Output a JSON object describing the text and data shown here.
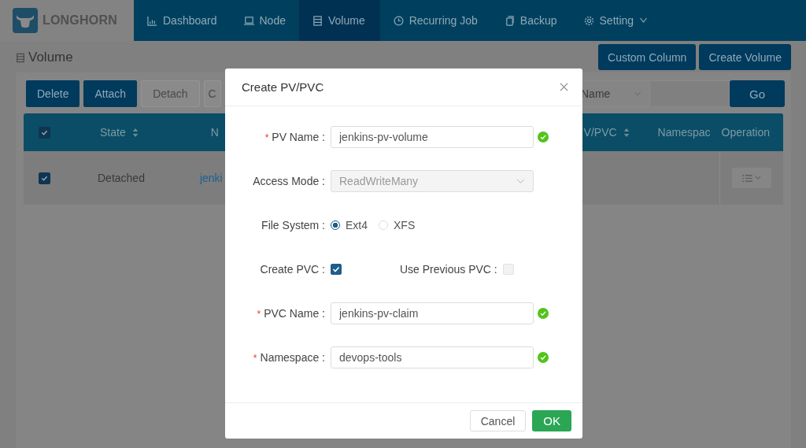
{
  "app": {
    "logo": "LONGHORN"
  },
  "nav": [
    {
      "label": "Dashboard",
      "selected": false
    },
    {
      "label": "Node",
      "selected": false
    },
    {
      "label": "Volume",
      "selected": true
    },
    {
      "label": "Recurring Job",
      "selected": false
    },
    {
      "label": "Backup",
      "selected": false
    },
    {
      "label": "Setting",
      "selected": false,
      "dropdown": true
    }
  ],
  "page": {
    "title": "Volume",
    "buttons": [
      "Custom Column",
      "Create Volume"
    ]
  },
  "toolbar": {
    "buttons": [
      {
        "label": "Delete",
        "disabled": false
      },
      {
        "label": "Attach",
        "disabled": false
      },
      {
        "label": "Detach",
        "disabled": true
      },
      {
        "label": "C",
        "disabled": true
      }
    ],
    "filter": {
      "field": "Name",
      "button": "Go"
    }
  },
  "table": {
    "select_all": true,
    "columns_left": [
      {
        "label": "State",
        "sortable": true
      },
      {
        "label": "N"
      }
    ],
    "columns_right": [
      {
        "label": "V/PVC",
        "sortable": true
      },
      {
        "label": "Namespac"
      },
      {
        "label": "Operation"
      }
    ],
    "rows": [
      {
        "checked": true,
        "state": "Detached",
        "name": "jenki"
      }
    ]
  },
  "dialog": {
    "title": "Create PV/PVC",
    "fields": [
      {
        "kind": "text",
        "marker": "*",
        "label": "PV Name :",
        "value": "jenkins-pv-volume",
        "valid": true
      },
      {
        "kind": "select",
        "label": "Access Mode :",
        "value": "ReadWriteMany",
        "disabled": true
      },
      {
        "kind": "radio",
        "label": "File System :",
        "options": [
          {
            "label": "Ext4",
            "selected": true
          },
          {
            "label": "XFS",
            "selected": false
          }
        ]
      },
      {
        "kind": "checks",
        "items": [
          {
            "label": "Create PVC :",
            "checked": true
          },
          {
            "label": "Use Previous PVC :",
            "checked": false
          }
        ]
      },
      {
        "kind": "text",
        "marker": "*",
        "label": "PVC Name :",
        "value": "jenkins-pv-claim",
        "valid": true
      },
      {
        "kind": "text",
        "marker": "*",
        "label": "Namespace :",
        "value": "devops-tools",
        "valid": true
      }
    ],
    "buttons": {
      "cancel": "Cancel",
      "ok": "OK"
    }
  }
}
